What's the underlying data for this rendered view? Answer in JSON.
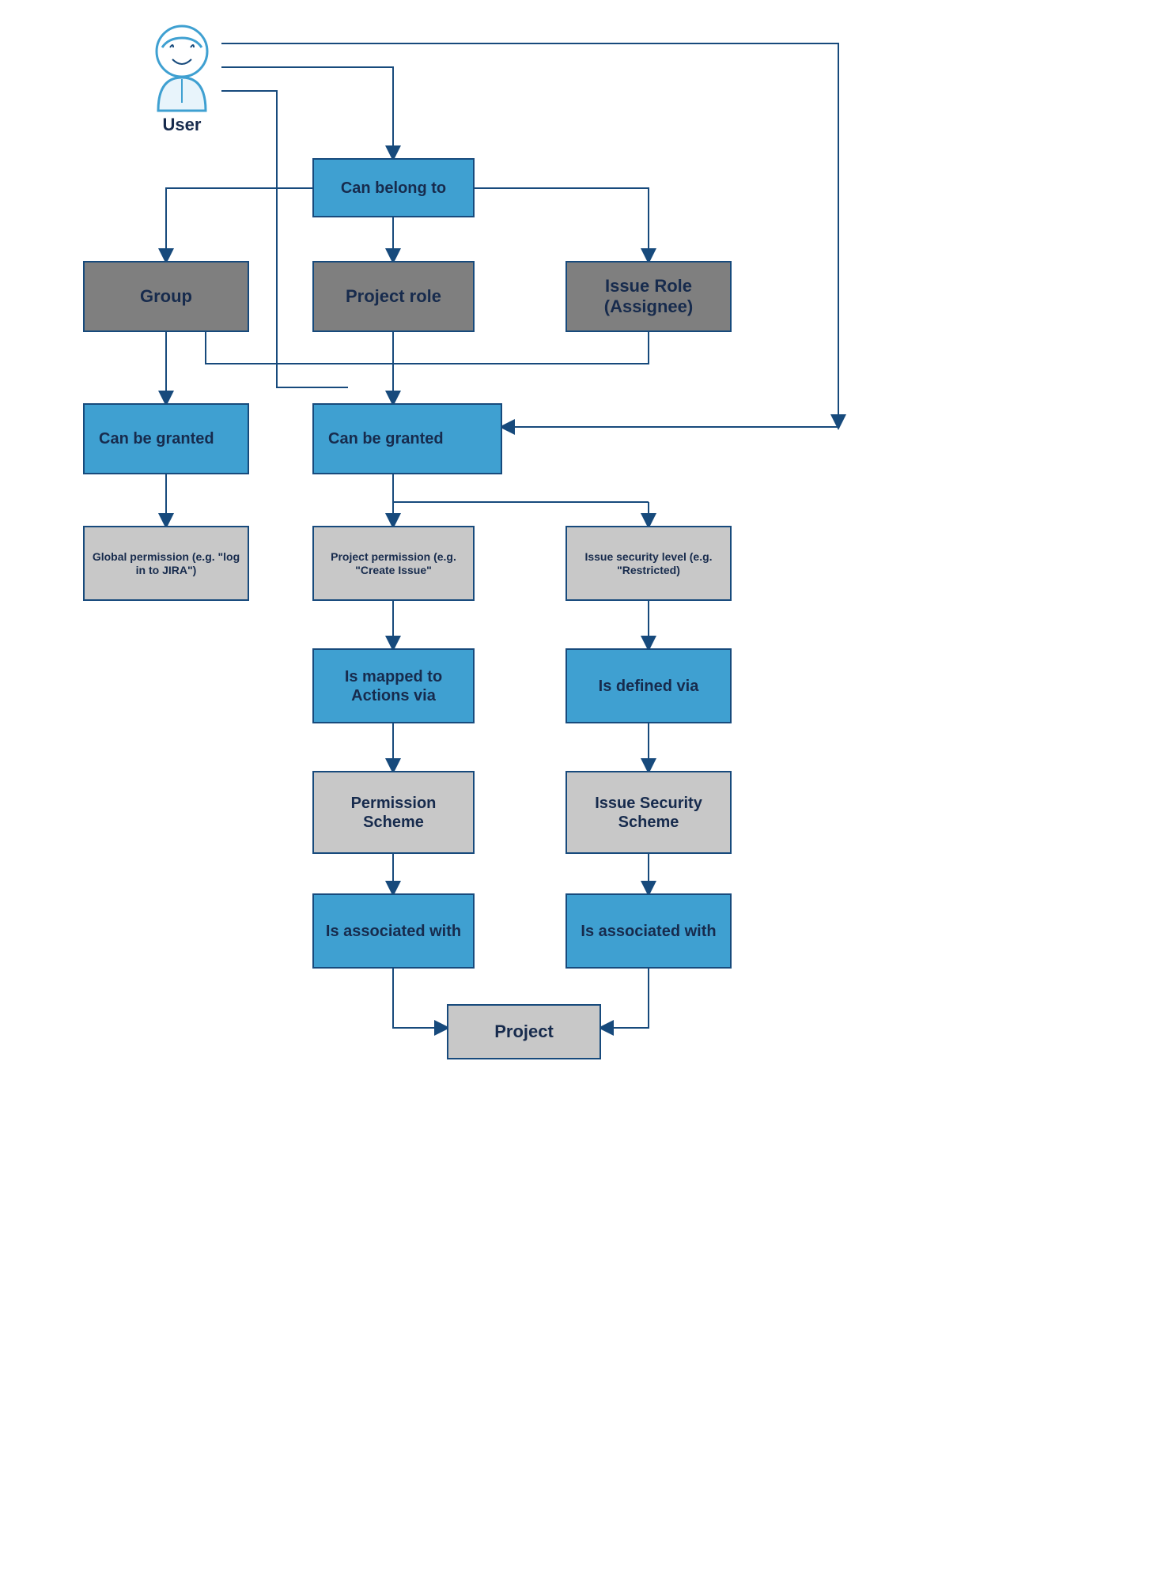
{
  "user_label": "User",
  "nodes": {
    "can_belong_to": "Can belong to",
    "group": "Group",
    "project_role": "Project role",
    "issue_role": "Issue Role (Assignee)",
    "can_be_granted_left": "Can be granted",
    "can_be_granted_mid": "Can be granted",
    "global_permission": "Global permission (e.g. \"log in to JIRA\")",
    "project_permission": "Project permission (e.g. \"Create Issue\"",
    "issue_security_level": "Issue security level (e.g. \"Restricted)",
    "is_mapped_to": "Is mapped to Actions via",
    "is_defined_via": "Is defined via",
    "permission_scheme": "Permission Scheme",
    "issue_security_scheme": "Issue Security Scheme",
    "is_associated_with_left": "Is associated with",
    "is_associated_with_right": "Is associated with",
    "project": "Project"
  },
  "colors": {
    "blue_fill": "#3fa0d1",
    "dark_fill": "#7f7f7f",
    "light_fill": "#c8c8c8",
    "stroke": "#174a7c"
  },
  "diagram": {
    "type": "flowchart",
    "description": "JIRA permission model: a User can belong to Group, Project role, or Issue Role. Groups can be granted Global permissions. Users/Groups/Project roles/Issue roles can be granted Project permissions (mapped to Permission Scheme associated with Project) and Issue security levels (defined via Issue Security Scheme associated with Project)."
  }
}
